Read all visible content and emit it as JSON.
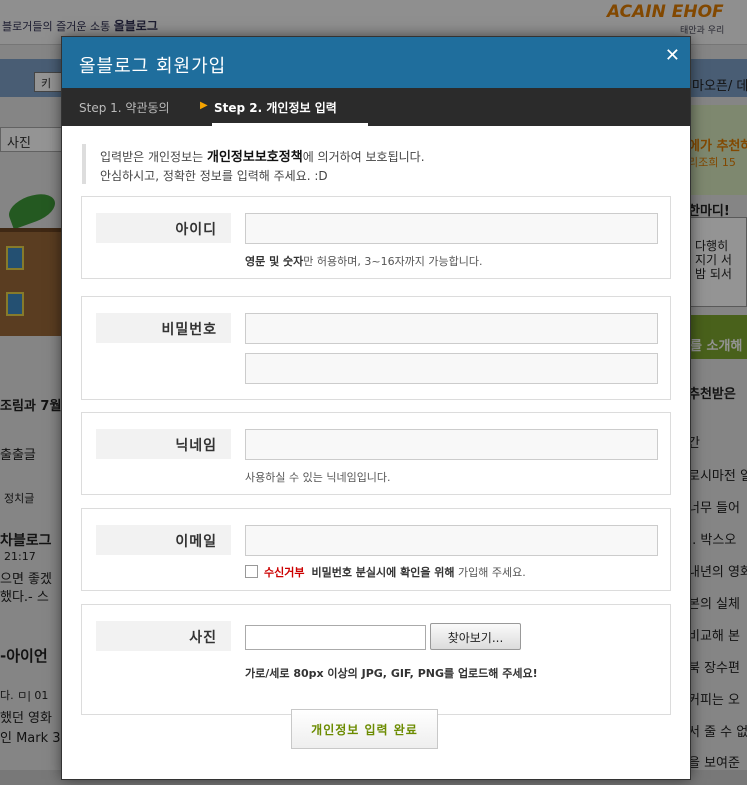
{
  "background": {
    "top_text": "블로거들의 즐거운 소통 ",
    "top_text_bold": "올블로그",
    "logo": "ACAIN EHOF",
    "logo_sub": "태안과 우리",
    "search_label": "키",
    "photo_tab": "사진",
    "right_texts": [
      "마오픈/ 데",
      "에가 추천하",
      "리조희 15",
      "한마디!",
      "다행히",
      "지기 서",
      "밤 되서",
      "를 소개해",
      "추천받은",
      "간",
      "로시마전 일",
      "너무 들어",
      ".. 박스오",
      "내년의 영화",
      "본의 실체",
      "비교해 본",
      "북 장수편",
      "커피는 오",
      "서 줄 수 없",
      "을 보여준"
    ],
    "left_texts": [
      "조림과 7월",
      "출출글",
      "정치글",
      "차블로그",
      "21:17",
      "으면 좋겠",
      "했다.- 스",
      "-아이언",
      "다. ㅁ| 01",
      "했던 영화",
      "인 Mark 3"
    ]
  },
  "modal": {
    "title": "올블로그 회원가입",
    "close": "✕",
    "step1": "Step 1. 약관동의",
    "step_arrow": "▶",
    "step2": "Step 2. 개인정보 입력",
    "notice_pre": "입력받은 개인정보는 ",
    "notice_bold": "개인정보보호정책",
    "notice_post": "에 의거하여 보호됩니다.",
    "notice_line2": "안심하시고, 정확한 정보를 입력해 주세요. :D",
    "fields": {
      "id": {
        "label": "아이디",
        "value": "",
        "help_bold": "영문 및 숫자",
        "help": "만 허용하며, 3~16자까지 가능합니다."
      },
      "password": {
        "label": "비밀번호",
        "value": "",
        "confirm_value": ""
      },
      "nickname": {
        "label": "닉네임",
        "value": "",
        "help": "사용하실 수 있는 닉네임입니다."
      },
      "email": {
        "label": "이메일",
        "value": "",
        "opt_out": "수신거부",
        "help_bold": "비밀번호 분실시에 확인을 위해",
        "help": " 가입해 주세요."
      },
      "photo": {
        "label": "사진",
        "browse": "찾아보기...",
        "help": "가로/세로 80px 이상의 JPG, GIF, PNG를 업로드해 주세요!"
      }
    },
    "submit": "개인정보 입력 완료"
  },
  "colors": {
    "header": "#1f6e9d",
    "steps_bar": "#2b2b2b",
    "accent_arrow": "#f6a400",
    "submit_text": "#6b8b00",
    "warning": "#cc0000"
  }
}
